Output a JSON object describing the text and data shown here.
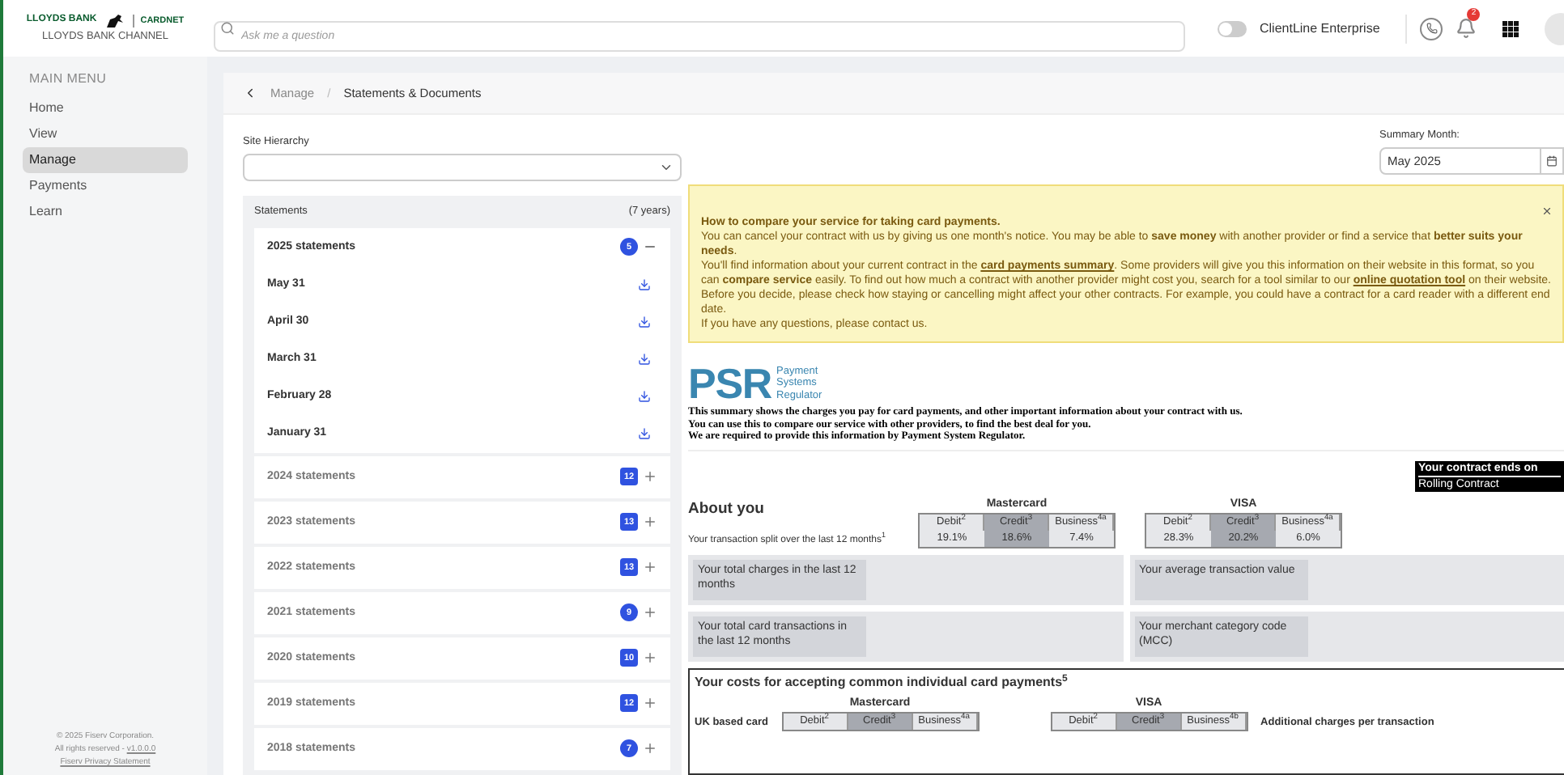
{
  "brand": {
    "bank": "LLOYDS BANK",
    "product": "CARDNET",
    "channel": "LLOYDS BANK CHANNEL"
  },
  "sidebar": {
    "heading": "MAIN MENU",
    "items": [
      {
        "label": "Home",
        "selected": false
      },
      {
        "label": "View",
        "selected": false
      },
      {
        "label": "Manage",
        "selected": true
      },
      {
        "label": "Payments",
        "selected": false
      },
      {
        "label": "Learn",
        "selected": false
      }
    ],
    "footer": {
      "copyright": "© 2025 Fiserv Corporation.",
      "rights": "All rights reserved - ",
      "version": "v1.0.0.0",
      "privacy": "Fiserv Privacy Statement"
    }
  },
  "top_bar": {
    "search": {
      "placeholder": "Ask me a question"
    },
    "toggle": {
      "label": "ClientLine Enterprise",
      "on": false
    },
    "notifications": "2"
  },
  "breadcrumb": {
    "parent": "Manage",
    "separator": "/",
    "current": "Statements & Documents"
  },
  "site_hierarchy": {
    "label": "Site Hierarchy"
  },
  "summary_month": {
    "label": "Summary Month:",
    "value": "May 2025"
  },
  "statements": {
    "title": "Statements",
    "range": "(7 years)",
    "groups": [
      {
        "label": "2025 statements",
        "count": "5",
        "expanded": true,
        "entries": [
          "May 31",
          "April 30",
          "March 31",
          "February 28",
          "January 31"
        ]
      },
      {
        "label": "2024 statements",
        "count": "12",
        "expanded": false
      },
      {
        "label": "2023 statements",
        "count": "13",
        "expanded": false
      },
      {
        "label": "2022 statements",
        "count": "13",
        "expanded": false
      },
      {
        "label": "2021 statements",
        "count": "9",
        "expanded": false
      },
      {
        "label": "2020 statements",
        "count": "10",
        "expanded": false
      },
      {
        "label": "2019 statements",
        "count": "12",
        "expanded": false
      },
      {
        "label": "2018 statements",
        "count": "7",
        "expanded": false
      }
    ]
  },
  "notice": {
    "title": "How to compare your service for taking card payments.",
    "paragraphs": [
      [
        {
          "kind": "text",
          "text": "You can cancel your contract with us by giving us one month's notice. You may be able to **save money** with another provider or find a service that **better suits your needs**."
        }
      ],
      [
        {
          "kind": "text",
          "text": "You'll find information about your current contract in the "
        },
        {
          "kind": "link",
          "text": "card payments summary"
        },
        {
          "kind": "text",
          "text": ". Some providers will give you this information on their website in this format, so you can **compare service** easily. To find out how much a contract with another provider might cost you, search for a tool similar to our "
        },
        {
          "kind": "link",
          "text": "online quotation tool"
        },
        {
          "kind": "text",
          "text": " on their website."
        }
      ],
      [
        {
          "kind": "text",
          "text": "Before you decide, please check how staying or cancelling might affect your other contracts. For example, you could have a contract for a card reader with a different end date."
        }
      ],
      [
        {
          "kind": "text",
          "text": "If you have any questions, please contact us."
        }
      ]
    ]
  },
  "psr": {
    "mark": "PSR",
    "name": [
      "Payment",
      "Systems",
      "Regulator"
    ],
    "intro": [
      "This summary shows the charges you pay for card payments, and other important information about your contract with us.",
      "You can use this to compare our service with other providers, to find the best deal for you.",
      "We are required to provide this information by Payment System Regulator."
    ]
  },
  "contract": {
    "label": "Your contract ends on",
    "value": "Rolling Contract"
  },
  "about_you": {
    "title": "About you",
    "row_label": "Your transaction split over the last 12 months$^{1}$",
    "schemes": [
      {
        "name": "Mastercard",
        "columns": [
          {
            "label": "Debit$^{2}$",
            "value": "19.1%",
            "highlighted": false
          },
          {
            "label": "Credit$^{3}$",
            "value": "18.6%",
            "highlighted": true
          },
          {
            "label": "Business$^{4a}$",
            "value": "7.4%",
            "highlighted": false
          }
        ]
      },
      {
        "name": "VISA",
        "columns": [
          {
            "label": "Debit$^{2}$",
            "value": "28.3%",
            "highlighted": false
          },
          {
            "label": "Credit$^{3}$",
            "value": "20.2%",
            "highlighted": true
          },
          {
            "label": "Business$^{4a}$",
            "value": "6.0%",
            "highlighted": false
          }
        ]
      }
    ],
    "facts": [
      "Your total charges in the last 12 months",
      "Your average transaction value",
      "Your total card transactions in the last 12 months",
      "Your merchant category code (MCC)"
    ]
  },
  "costs": {
    "title": "Your costs for accepting common individual card payments$^{5}$",
    "row_label": "UK based card",
    "extra": "Additional charges per transaction",
    "schemes": [
      {
        "name": "Mastercard",
        "columns": [
          {
            "label": "Debit$^{2}$",
            "highlighted": false
          },
          {
            "label": "Credit$^{3}$",
            "highlighted": true
          },
          {
            "label": "Business$^{4a}$",
            "highlighted": false
          }
        ]
      },
      {
        "name": "VISA",
        "columns": [
          {
            "label": "Debit$^{2}$",
            "highlighted": false
          },
          {
            "label": "Credit$^{3}$",
            "highlighted": true
          },
          {
            "label": "Business$^{4b}$",
            "highlighted": false
          }
        ]
      }
    ]
  }
}
